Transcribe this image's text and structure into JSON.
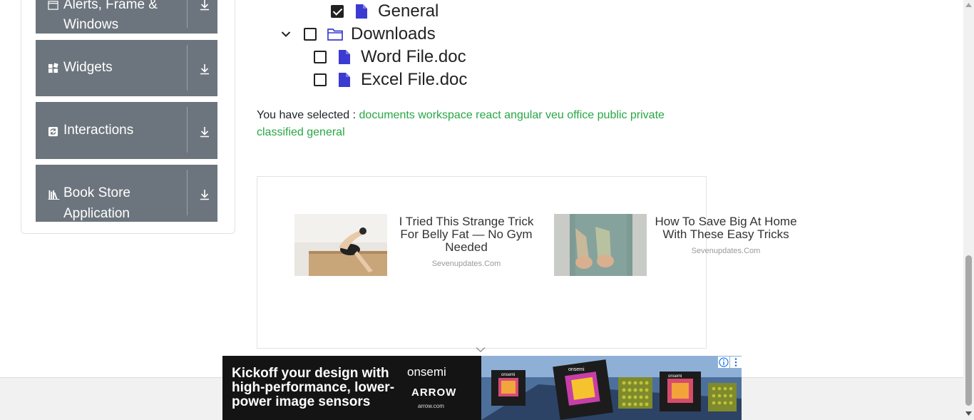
{
  "sidebar": {
    "groups": [
      {
        "label_line1": "Alerts, Frame &",
        "label_line2": "Windows",
        "icon": "window-icon"
      },
      {
        "label": "Widgets",
        "icon": "widgets-icon"
      },
      {
        "label": "Interactions",
        "icon": "interactions-icon"
      },
      {
        "label_line1": "Book Store",
        "label_line2": "Application",
        "icon": "books-icon"
      }
    ]
  },
  "tree": {
    "general": "General",
    "downloads": "Downloads",
    "word_file": "Word File.doc",
    "excel_file": "Excel File.doc"
  },
  "selection": {
    "label": "You have selected :",
    "values_line1": "documents workspace react angular veu office public private",
    "values_line2": "classified general"
  },
  "ad": {
    "cards": [
      {
        "title_line1": "I Tried This Strange Trick",
        "title_line2": "For Belly Fat — No Gym",
        "title_line3": "Needed",
        "source": "Sevenupdates.Com"
      },
      {
        "title_line1": "How To Save Big At Home",
        "title_line2": "With These Easy Tricks",
        "source": "Sevenupdates.Com"
      }
    ]
  },
  "banner": {
    "headline_line1": "Kickoff your design with",
    "headline_line2": "high-performance, lower-",
    "headline_line3": "power image sensors",
    "brand1": "onsemi",
    "brand2": "ARROW",
    "brand2_url": "arrow.com",
    "chip_labels": [
      "onsemi",
      "onsemi",
      "onsemi"
    ]
  },
  "colors": {
    "sidebar_group_bg": "#6c757d",
    "selected_values": "#28a745",
    "file_icon": "#3b3bd1",
    "folder_icon": "#3b3bd1"
  }
}
